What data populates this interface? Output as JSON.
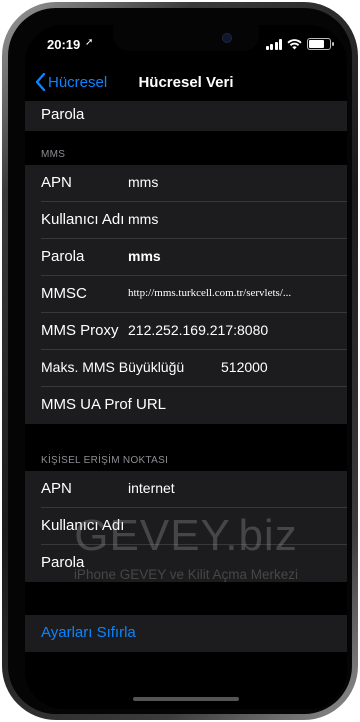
{
  "status_bar": {
    "time": "20:19",
    "location_arrow": "location-arrow-icon",
    "wifi": "wifi-icon",
    "battery_level": 0.85
  },
  "nav": {
    "back_label": "Hücresel",
    "title": "Hücresel Veri"
  },
  "top_partial": {
    "label": "Parola"
  },
  "mms": {
    "header": "MMS",
    "rows": [
      {
        "label": "APN",
        "value": "mms"
      },
      {
        "label": "Kullanıcı Adı",
        "value": "mms"
      },
      {
        "label": "Parola",
        "value": "mms"
      },
      {
        "label": "MMSC",
        "value": "http://mms.turkcell.com.tr/servlets/..."
      },
      {
        "label": "MMS Proxy",
        "value": "212.252.169.217:8080"
      },
      {
        "label": "Maks. MMS Büyüklüğü",
        "value": "512000"
      },
      {
        "label": "MMS UA Prof URL",
        "value": ""
      }
    ]
  },
  "hotspot": {
    "header": "KİŞİSEL ERİŞİM NOKTASI",
    "rows": [
      {
        "label": "APN",
        "value": "internet"
      },
      {
        "label": "Kullanıcı Adı",
        "value": ""
      },
      {
        "label": "Parola",
        "value": ""
      }
    ]
  },
  "reset": {
    "label": "Ayarları Sıfırla"
  },
  "watermark": {
    "main": "GEVEY.biz",
    "sub": "iPhone GEVEY ve Kilit Açma Merkezi"
  },
  "colors": {
    "accent": "#0a84ff",
    "cell_bg": "#1c1c1e",
    "background": "#000000",
    "section_text": "#8e8e93"
  }
}
